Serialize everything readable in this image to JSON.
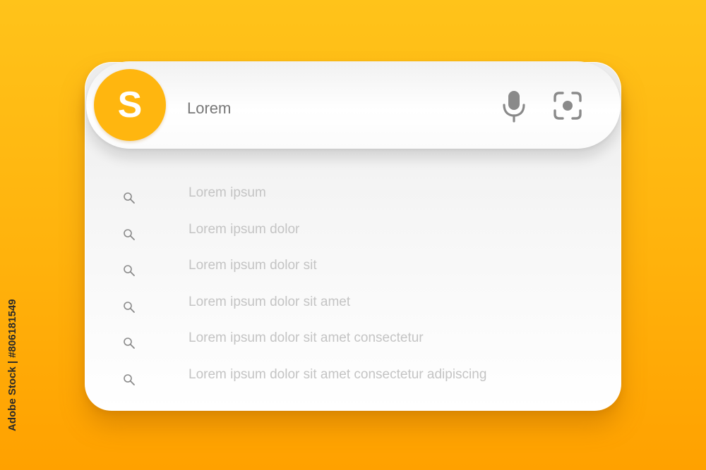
{
  "colors": {
    "background": "#ffb20c",
    "brand": "#ffb60f",
    "panel": "#f6f6f6",
    "query_text": "#777777",
    "suggestion_text": "#c4c4c4",
    "icon": "#8a8a8a"
  },
  "search": {
    "logo_letter": "S",
    "query": "Lorem",
    "mic_icon": "microphone-icon",
    "lens_icon": "camera-scan-icon"
  },
  "suggestions": [
    {
      "icon": "search-icon",
      "text": "Lorem ipsum"
    },
    {
      "icon": "search-icon",
      "text": "Lorem ipsum dolor"
    },
    {
      "icon": "search-icon",
      "text": "Lorem ipsum dolor sit"
    },
    {
      "icon": "search-icon",
      "text": "Lorem ipsum dolor sit amet"
    },
    {
      "icon": "search-icon",
      "text": "Lorem ipsum dolor sit amet consectetur"
    },
    {
      "icon": "search-icon",
      "text": "Lorem ipsum dolor sit amet consectetur adipiscing"
    }
  ],
  "watermark": {
    "text": "Adobe Stock | #806181549"
  }
}
